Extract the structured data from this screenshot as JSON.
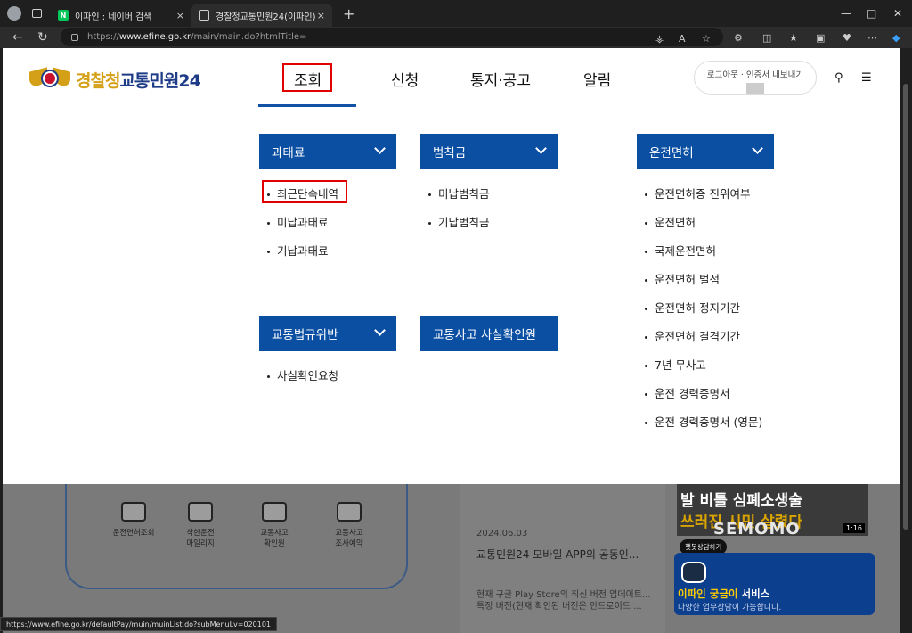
{
  "browser": {
    "tabs": [
      {
        "title": "이파인 : 네이버 검색",
        "favicon": "N"
      },
      {
        "title": "경찰청교통민원24(이파인)"
      }
    ],
    "close": "×",
    "newtab": "+",
    "url_prefix": "https://",
    "url_domain": "www.efine.go.kr",
    "url_path": "/main/main.do?htmlTitle=",
    "status_url": "https://www.efine.go.kr/defaultPay/muin/muinList.do?subMenuLv=020101"
  },
  "header": {
    "logo_prefix": "경찰청",
    "logo_main": "교통민원24",
    "menu": [
      "조회",
      "신청",
      "통지·공고",
      "알림"
    ],
    "login_text": "로그아웃 · 인증서 내보내기"
  },
  "mega": {
    "cat_gwatae": "과태료",
    "gwatae_items": [
      "최근단속내역",
      "미납과태료",
      "기납과태료"
    ],
    "cat_beomchik": "범칙금",
    "beomchik_items": [
      "미납범칙금",
      "기납범칙금"
    ],
    "cat_license": "운전면허",
    "license_items": [
      "운전면허증 진위여부",
      "운전면허",
      "국제운전면허",
      "운전면허 벌점",
      "운전면허 정지기간",
      "운전면허 결격기간",
      "7년 무사고",
      "운전 경력증명서",
      "운전 경력증명서 (영문)"
    ],
    "cat_violation": "교통법규위반",
    "violation_items": [
      "사실확인요청"
    ],
    "cat_accident": "교통사고 사실확인원"
  },
  "bottom": {
    "services": [
      "운전면허조회",
      "착한운전\n마일리지",
      "교통사고\n확인원",
      "교통사고\n조사예약"
    ],
    "news_date": "2024.06.03",
    "news_title": "교통민원24 모바일 APP의 공동인...",
    "news_excerpt": "현재 구글 Play Store의 최신 버전 업데이트...\n특정 버전(현재 확인된 버전은 안드로이드 ...",
    "video_line1": "발 비틀 심폐소생술",
    "video_line2": "쓰러진 시민 살렸다",
    "video_duration": "1:16",
    "watermark": "SEMOMO",
    "chat_bubble": "챗봇상담하기",
    "chat_title_highlight": "이파인 궁금이",
    "chat_title_rest": " 서비스",
    "chat_sub": "다양한 업무상담이 가능합니다."
  }
}
